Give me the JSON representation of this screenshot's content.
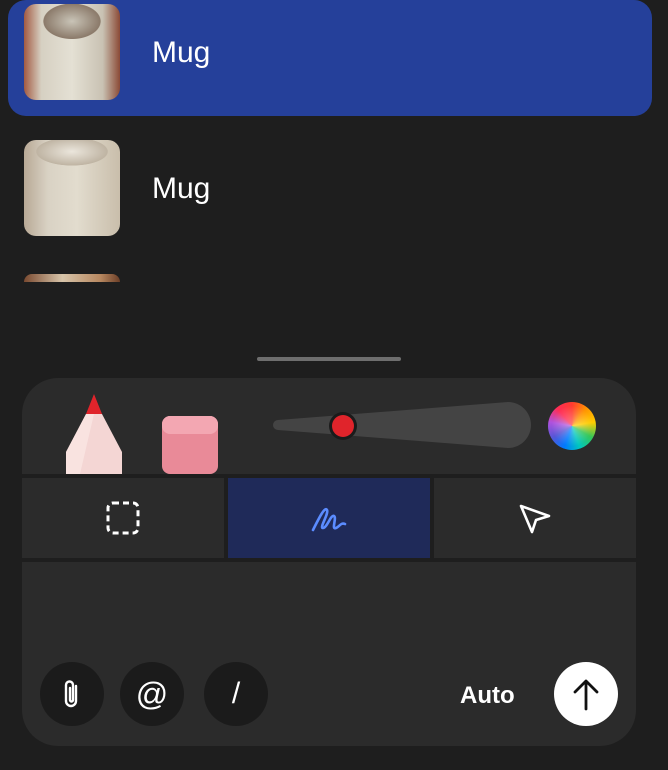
{
  "list": {
    "items": [
      {
        "label": "Mug",
        "selected": true,
        "thumbnail": "mug-photo"
      },
      {
        "label": "Mug",
        "selected": false,
        "thumbnail": "mug-photo"
      }
    ]
  },
  "toolbar": {
    "tools": [
      "pen-icon",
      "eraser-icon"
    ],
    "pen_color": "#e0242b",
    "size_slider_level": 0.2,
    "color_picker": "color-wheel-icon"
  },
  "modes": {
    "items": [
      {
        "name": "lasso-select",
        "icon": "dashed-square-icon",
        "active": false
      },
      {
        "name": "draw",
        "icon": "scribble-icon",
        "active": true
      },
      {
        "name": "pointer",
        "icon": "cursor-arrow-icon",
        "active": false
      }
    ]
  },
  "composer": {
    "attach_icon": "paperclip-icon",
    "mention_label": "@",
    "command_label": "/",
    "model_label": "Auto",
    "send_icon": "arrow-up-icon"
  },
  "colors": {
    "selected_row": "#25409a",
    "active_mode": "#1f2a59",
    "accent_blue": "#5b8cff"
  }
}
